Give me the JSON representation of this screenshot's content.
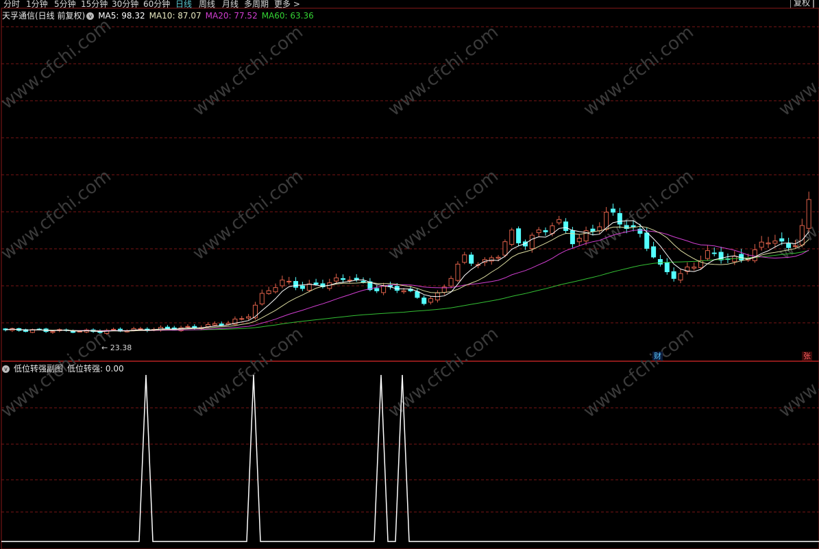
{
  "tabs": [
    {
      "label": "分时"
    },
    {
      "label": "1分钟"
    },
    {
      "label": "5分钟"
    },
    {
      "label": "15分钟"
    },
    {
      "label": "30分钟"
    },
    {
      "label": "60分钟"
    },
    {
      "label": "日线",
      "active": true
    },
    {
      "label": "周线"
    },
    {
      "label": "月线"
    },
    {
      "label": "多周期"
    },
    {
      "label": "更多 >"
    }
  ],
  "adjust_button": "复权",
  "main": {
    "title": "天孚通信(日线 前复权)",
    "ma5": "MA5: 98.32",
    "ma10": "MA10: 87.07",
    "ma20": "MA20: 77.52",
    "ma60": "MA60: 63.36",
    "low_label": "← 23.38",
    "marker_cai": "财",
    "marker_zhang": "张"
  },
  "colors": {
    "up": "#e0614a",
    "down": "#54ffff",
    "ma5": "#ffffff",
    "ma10": "#dcdca0",
    "ma20": "#d23fd2",
    "ma60": "#34c034",
    "grid": "#7a1616",
    "border": "#8a1a1a",
    "ma20_label": "#d23fd2",
    "ma60_label": "#34d334",
    "signal": "#ffffff",
    "watermark": "#3a3a3a"
  },
  "sub": {
    "title": "低位转强副图",
    "value": "低位转强: 0.00",
    "spike_dates": [
      13,
      24,
      37,
      39
    ]
  },
  "watermark": "www.cfchi.com"
}
